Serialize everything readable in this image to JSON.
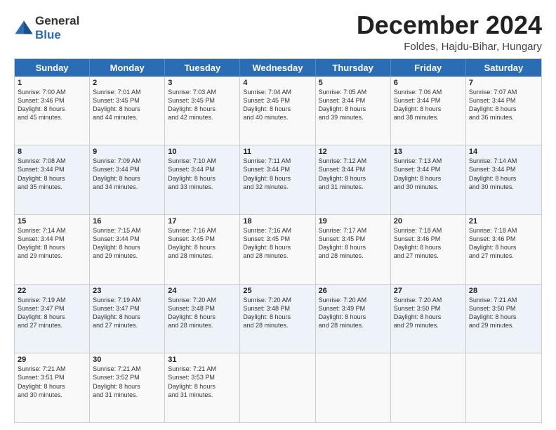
{
  "header": {
    "logo_line1": "General",
    "logo_line2": "Blue",
    "month_title": "December 2024",
    "location": "Foldes, Hajdu-Bihar, Hungary"
  },
  "days_of_week": [
    "Sunday",
    "Monday",
    "Tuesday",
    "Wednesday",
    "Thursday",
    "Friday",
    "Saturday"
  ],
  "weeks": [
    [
      {
        "day": "1",
        "lines": [
          "Sunrise: 7:00 AM",
          "Sunset: 3:46 PM",
          "Daylight: 8 hours",
          "and 45 minutes."
        ]
      },
      {
        "day": "2",
        "lines": [
          "Sunrise: 7:01 AM",
          "Sunset: 3:45 PM",
          "Daylight: 8 hours",
          "and 44 minutes."
        ]
      },
      {
        "day": "3",
        "lines": [
          "Sunrise: 7:03 AM",
          "Sunset: 3:45 PM",
          "Daylight: 8 hours",
          "and 42 minutes."
        ]
      },
      {
        "day": "4",
        "lines": [
          "Sunrise: 7:04 AM",
          "Sunset: 3:45 PM",
          "Daylight: 8 hours",
          "and 40 minutes."
        ]
      },
      {
        "day": "5",
        "lines": [
          "Sunrise: 7:05 AM",
          "Sunset: 3:44 PM",
          "Daylight: 8 hours",
          "and 39 minutes."
        ]
      },
      {
        "day": "6",
        "lines": [
          "Sunrise: 7:06 AM",
          "Sunset: 3:44 PM",
          "Daylight: 8 hours",
          "and 38 minutes."
        ]
      },
      {
        "day": "7",
        "lines": [
          "Sunrise: 7:07 AM",
          "Sunset: 3:44 PM",
          "Daylight: 8 hours",
          "and 36 minutes."
        ]
      }
    ],
    [
      {
        "day": "8",
        "lines": [
          "Sunrise: 7:08 AM",
          "Sunset: 3:44 PM",
          "Daylight: 8 hours",
          "and 35 minutes."
        ]
      },
      {
        "day": "9",
        "lines": [
          "Sunrise: 7:09 AM",
          "Sunset: 3:44 PM",
          "Daylight: 8 hours",
          "and 34 minutes."
        ]
      },
      {
        "day": "10",
        "lines": [
          "Sunrise: 7:10 AM",
          "Sunset: 3:44 PM",
          "Daylight: 8 hours",
          "and 33 minutes."
        ]
      },
      {
        "day": "11",
        "lines": [
          "Sunrise: 7:11 AM",
          "Sunset: 3:44 PM",
          "Daylight: 8 hours",
          "and 32 minutes."
        ]
      },
      {
        "day": "12",
        "lines": [
          "Sunrise: 7:12 AM",
          "Sunset: 3:44 PM",
          "Daylight: 8 hours",
          "and 31 minutes."
        ]
      },
      {
        "day": "13",
        "lines": [
          "Sunrise: 7:13 AM",
          "Sunset: 3:44 PM",
          "Daylight: 8 hours",
          "and 30 minutes."
        ]
      },
      {
        "day": "14",
        "lines": [
          "Sunrise: 7:14 AM",
          "Sunset: 3:44 PM",
          "Daylight: 8 hours",
          "and 30 minutes."
        ]
      }
    ],
    [
      {
        "day": "15",
        "lines": [
          "Sunrise: 7:14 AM",
          "Sunset: 3:44 PM",
          "Daylight: 8 hours",
          "and 29 minutes."
        ]
      },
      {
        "day": "16",
        "lines": [
          "Sunrise: 7:15 AM",
          "Sunset: 3:44 PM",
          "Daylight: 8 hours",
          "and 29 minutes."
        ]
      },
      {
        "day": "17",
        "lines": [
          "Sunrise: 7:16 AM",
          "Sunset: 3:45 PM",
          "Daylight: 8 hours",
          "and 28 minutes."
        ]
      },
      {
        "day": "18",
        "lines": [
          "Sunrise: 7:16 AM",
          "Sunset: 3:45 PM",
          "Daylight: 8 hours",
          "and 28 minutes."
        ]
      },
      {
        "day": "19",
        "lines": [
          "Sunrise: 7:17 AM",
          "Sunset: 3:45 PM",
          "Daylight: 8 hours",
          "and 28 minutes."
        ]
      },
      {
        "day": "20",
        "lines": [
          "Sunrise: 7:18 AM",
          "Sunset: 3:46 PM",
          "Daylight: 8 hours",
          "and 27 minutes."
        ]
      },
      {
        "day": "21",
        "lines": [
          "Sunrise: 7:18 AM",
          "Sunset: 3:46 PM",
          "Daylight: 8 hours",
          "and 27 minutes."
        ]
      }
    ],
    [
      {
        "day": "22",
        "lines": [
          "Sunrise: 7:19 AM",
          "Sunset: 3:47 PM",
          "Daylight: 8 hours",
          "and 27 minutes."
        ]
      },
      {
        "day": "23",
        "lines": [
          "Sunrise: 7:19 AM",
          "Sunset: 3:47 PM",
          "Daylight: 8 hours",
          "and 27 minutes."
        ]
      },
      {
        "day": "24",
        "lines": [
          "Sunrise: 7:20 AM",
          "Sunset: 3:48 PM",
          "Daylight: 8 hours",
          "and 28 minutes."
        ]
      },
      {
        "day": "25",
        "lines": [
          "Sunrise: 7:20 AM",
          "Sunset: 3:48 PM",
          "Daylight: 8 hours",
          "and 28 minutes."
        ]
      },
      {
        "day": "26",
        "lines": [
          "Sunrise: 7:20 AM",
          "Sunset: 3:49 PM",
          "Daylight: 8 hours",
          "and 28 minutes."
        ]
      },
      {
        "day": "27",
        "lines": [
          "Sunrise: 7:20 AM",
          "Sunset: 3:50 PM",
          "Daylight: 8 hours",
          "and 29 minutes."
        ]
      },
      {
        "day": "28",
        "lines": [
          "Sunrise: 7:21 AM",
          "Sunset: 3:50 PM",
          "Daylight: 8 hours",
          "and 29 minutes."
        ]
      }
    ],
    [
      {
        "day": "29",
        "lines": [
          "Sunrise: 7:21 AM",
          "Sunset: 3:51 PM",
          "Daylight: 8 hours",
          "and 30 minutes."
        ]
      },
      {
        "day": "30",
        "lines": [
          "Sunrise: 7:21 AM",
          "Sunset: 3:52 PM",
          "Daylight: 8 hours",
          "and 31 minutes."
        ]
      },
      {
        "day": "31",
        "lines": [
          "Sunrise: 7:21 AM",
          "Sunset: 3:53 PM",
          "Daylight: 8 hours",
          "and 31 minutes."
        ]
      },
      null,
      null,
      null,
      null
    ]
  ]
}
